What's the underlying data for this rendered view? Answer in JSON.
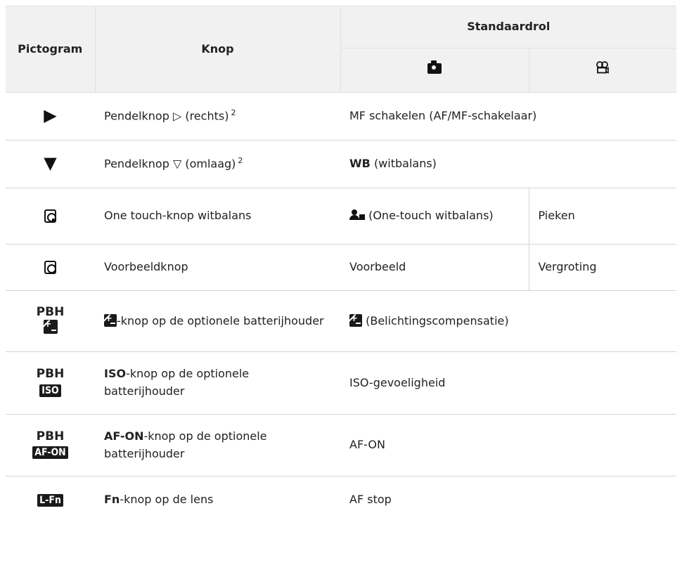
{
  "header": {
    "col_pictogram": "Pictogram",
    "col_knop": "Knop",
    "col_standaardrol": "Standaardrol",
    "sub_photo_icon": "camera-icon",
    "sub_video_icon": "movie-camera-icon"
  },
  "rows": [
    {
      "icon": "right-triangle-icon",
      "knop_text": "Pendelknop ▷ (rechts)",
      "sup": "2",
      "role": "MF schakelen (AF/MF-schakelaar)"
    },
    {
      "icon": "down-triangle-icon",
      "knop_text": "Pendelknop ▽ (omlaag)",
      "sup": "2",
      "role_bold": "WB",
      "role_rest": "(witbalans)"
    },
    {
      "icon": "one-touch-wb-button-icon",
      "knop_text": "One touch-knop witbalans",
      "role_photo_icon": "one-touch-wb-icon",
      "role_photo": "(One-touch witbalans)",
      "role_video": "Pieken"
    },
    {
      "icon": "preview-button-icon",
      "knop_text": "Voorbeeldknop",
      "role_photo": "Voorbeeld",
      "role_video": "Vergroting"
    },
    {
      "icon_label": "PBH",
      "icon": "exposure-compensation-icon",
      "knop_rest": "-knop op de optionele batterijhouder",
      "role": "(Belichtingscompensatie)"
    },
    {
      "icon_label": "PBH",
      "badge": "ISO",
      "knop_bold": "ISO",
      "knop_rest": "-knop op de optionele batterijhouder",
      "role": "ISO-gevoeligheid"
    },
    {
      "icon_label": "PBH",
      "badge": "AF-ON",
      "knop_bold": "AF-ON",
      "knop_rest": "-knop op de optionele batterijhouder",
      "role": "AF-ON"
    },
    {
      "badge": "L-Fn",
      "knop_bold": "Fn",
      "knop_rest": "-knop op de lens",
      "role": "AF stop"
    }
  ]
}
